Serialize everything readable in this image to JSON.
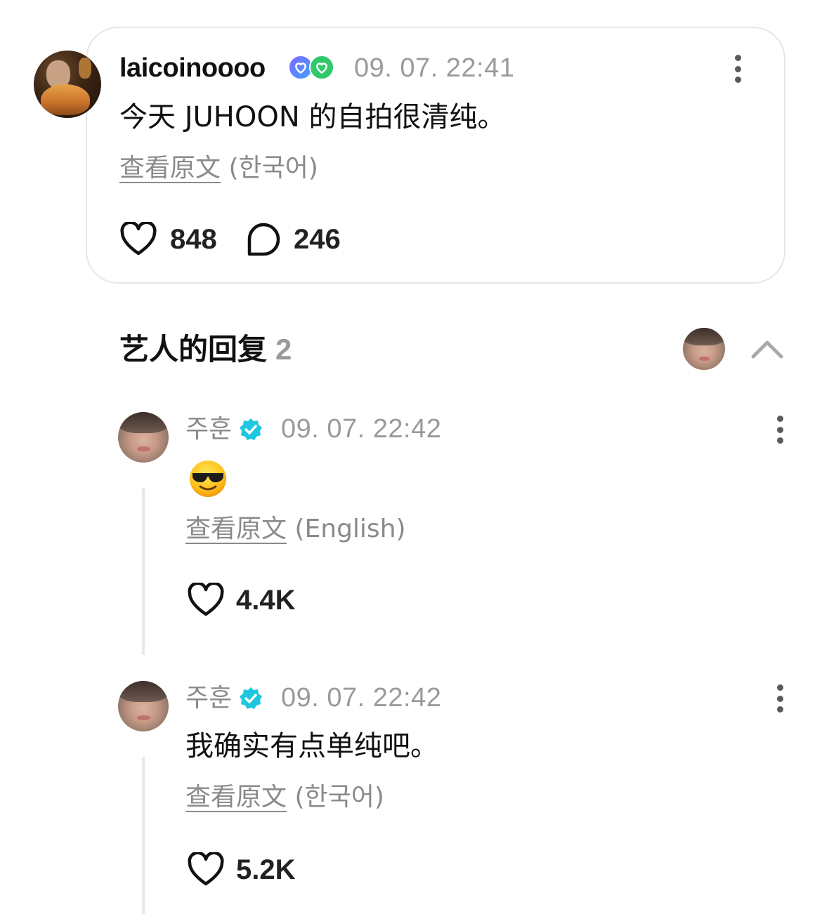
{
  "post": {
    "username": "laicoinoooo",
    "timestamp": "09. 07. 22:41",
    "text": "今天 JUHOON 的自拍很清纯。",
    "translate_label": "查看原文",
    "source_language": "(한국어)",
    "likes": "848",
    "comments": "246",
    "badges": [
      "heart-badge-blue",
      "heart-badge-green"
    ]
  },
  "artist_replies": {
    "title": "艺人的回复",
    "count": "2"
  },
  "replies": [
    {
      "name": "주훈",
      "verified": true,
      "timestamp": "09. 07. 22:42",
      "content_emoji": "smiling-face-with-sunglasses",
      "translate_label": "查看原文",
      "source_language": "(English)",
      "likes": "4.4K"
    },
    {
      "name": "주훈",
      "verified": true,
      "timestamp": "09. 07. 22:42",
      "text": "我确实有点单纯吧。",
      "translate_label": "查看原文",
      "source_language": "(한국어)",
      "likes": "5.2K"
    }
  ],
  "colors": {
    "verified": "#1fc6e0",
    "muted_text": "#8a8a8a",
    "card_border": "#e6e6e6"
  }
}
